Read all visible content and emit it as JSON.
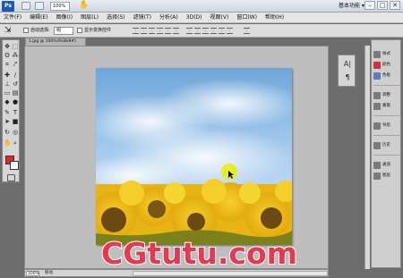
{
  "titlebar": {
    "app_logo": "Ps",
    "zoom": "100%",
    "workspace": "基本功能 ▾",
    "minimize": "–",
    "maximize": "□",
    "close": "✕"
  },
  "menu": [
    "文件(F)",
    "编辑(E)",
    "图像(I)",
    "图层(L)",
    "选择(S)",
    "滤镜(T)",
    "分析(A)",
    "3D(D)",
    "视图(V)",
    "窗口(W)",
    "帮助(H)"
  ],
  "options": {
    "auto_select_label": "自动选择:",
    "auto_select_value": "组",
    "show_transform_label": "显示变换控件"
  },
  "document": {
    "tab_title": "1.jpg @ 100%(RGB/8#)",
    "zoom": "100%",
    "info": "移动"
  },
  "panels": {
    "mini": [
      "A|",
      "¶"
    ],
    "dock": [
      {
        "icon": "styles-icon",
        "label": "样式"
      },
      {
        "icon": "swatches-icon",
        "label": "颜色"
      },
      {
        "icon": "color-icon",
        "label": "色板"
      },
      {
        "icon": "adjustments-icon",
        "label": "调整"
      },
      {
        "icon": "masks-icon",
        "label": "蒙版"
      },
      {
        "icon": "navigator-icon",
        "label": "导航"
      },
      {
        "icon": "history-icon",
        "label": "历史"
      },
      {
        "icon": "channels-icon",
        "label": "通道"
      },
      {
        "icon": "layers-icon",
        "label": "图层"
      }
    ]
  },
  "watermark": "CGtutu.com",
  "colors": {
    "foreground": "#ee2222",
    "background": "#ffffff",
    "watermark": "#e6394f"
  }
}
